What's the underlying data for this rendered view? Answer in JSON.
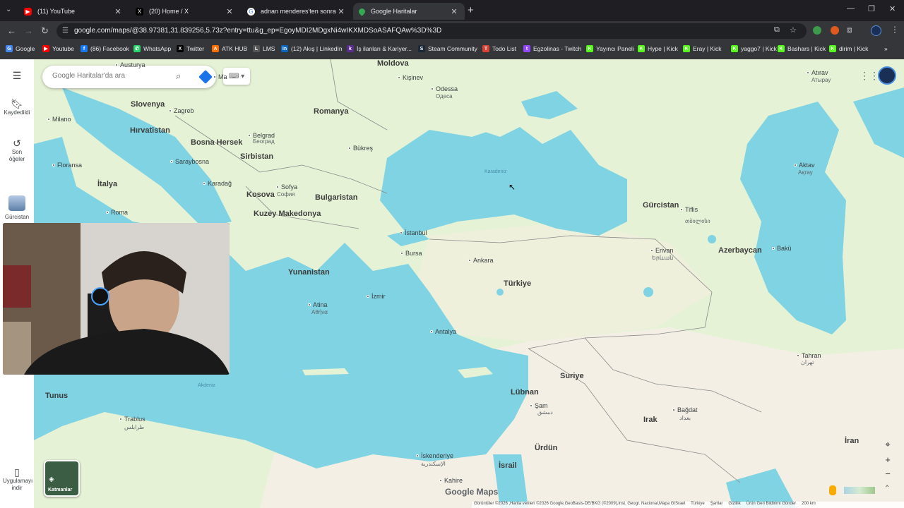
{
  "tabs": [
    {
      "title": "(11) YouTube",
      "icon": "youtube-icon",
      "color": "#ff0000"
    },
    {
      "title": "(20) Home / X",
      "icon": "x-icon",
      "color": "#000000"
    },
    {
      "title": "adnan menderes'ten sonraki cu",
      "icon": "google-icon",
      "color": "#4285f4"
    },
    {
      "title": "Google Haritalar",
      "icon": "maps-icon",
      "color": "#34a853"
    }
  ],
  "address": {
    "url": "google.com/maps/@38.97381,31.839256,5.73z?entry=ttu&g_ep=EgoyMDI2MDgxNi4wIKXMDSoASAFQAw%3D%3D"
  },
  "bookmarks": [
    {
      "label": "Google",
      "color": "#4285f4",
      "glyph": "G"
    },
    {
      "label": "Youtube",
      "color": "#ff0000",
      "glyph": "▶"
    },
    {
      "label": "(86) Facebook",
      "color": "#1877f2",
      "glyph": "f"
    },
    {
      "label": "WhatsApp",
      "color": "#25d366",
      "glyph": "✆"
    },
    {
      "label": "Twitter",
      "color": "#000000",
      "glyph": "X"
    },
    {
      "label": "ATK HUB",
      "color": "#ff6d00",
      "glyph": "A"
    },
    {
      "label": "LMS",
      "color": "#555555",
      "glyph": "L"
    },
    {
      "label": "(12) Akış | LinkedIn",
      "color": "#0a66c2",
      "glyph": "in"
    },
    {
      "label": "İş ilanları & Kariyer...",
      "color": "#5c2d91",
      "glyph": "k"
    },
    {
      "label": "Steam Community",
      "color": "#1b2838",
      "glyph": "S"
    },
    {
      "label": "Todo List",
      "color": "#db4035",
      "glyph": "T"
    },
    {
      "label": "Egzolinas - Twitch",
      "color": "#9146ff",
      "glyph": "t"
    },
    {
      "label": "Yayıncı Paneli",
      "color": "#53fc18",
      "glyph": "K"
    },
    {
      "label": "Hype | Kick",
      "color": "#53fc18",
      "glyph": "K"
    },
    {
      "label": "Eray | Kick",
      "color": "#53fc18",
      "glyph": "K"
    },
    {
      "label": "yaggo7 | Kick",
      "color": "#53fc18",
      "glyph": "K"
    },
    {
      "label": "Bashars | Kick",
      "color": "#53fc18",
      "glyph": "K"
    },
    {
      "label": "dirim | Kick",
      "color": "#53fc18",
      "glyph": "K"
    }
  ],
  "sidebar": {
    "saved": "Kaydedildi",
    "recent": "Son öğeler",
    "recent_place": "Gürcistan",
    "get_app": "Uygulamayı indir"
  },
  "search": {
    "placeholder": "Google Haritalar'da ara"
  },
  "layers": {
    "label": "Katmanlar"
  },
  "map_labels": {
    "countries": [
      "Moldova",
      "Romanya",
      "Slovenya",
      "Hırvatistan",
      "Bosna Hersek",
      "Sirbistan",
      "Bulgaristan",
      "İtalya",
      "Kosova",
      "Kuzey Makedonya",
      "Yunanistan",
      "Türkiye",
      "Gürcistan",
      "Azerbaycan",
      "Suriye",
      "Lübnan",
      "Irak",
      "Ürdün",
      "İsrail",
      "İran",
      "Tunus"
    ],
    "cities": [
      "Kişinev",
      "Odessa",
      "Zagreb",
      "Milano",
      "Bükreş",
      "Saraybosna",
      "Belgrad",
      "Floransa",
      "Karadağ",
      "Sofya",
      "Roma",
      "İstanbul",
      "Bursa",
      "Ankara",
      "İzmir",
      "Atina",
      "Antalya",
      "Tiflis",
      "Erivan",
      "Bakü",
      "Aktav",
      "Atırav",
      "Tahran",
      "Bağdat",
      "Şam",
      "Trablus",
      "İskenderiye",
      "Kahire",
      "Austurya",
      "Ma"
    ],
    "native": [
      "Одеса",
      "Београд",
      "София",
      "Αθήνα",
      "თბილისი",
      "Երևան",
      "Атырау",
      "Ақтау",
      "تهران",
      "بغداد",
      "دمشق",
      "طرابلس",
      "الإسكندرية"
    ],
    "seas": [
      "Karadeniz",
      "Akdeniz"
    ]
  },
  "footer": [
    "Görüntüler ©2026 ,Harita verileri ©2026 Google,GeoBasis-DE/BKG (©2009),Inst. Geogr. Nacional,Mapa GISrael",
    "Türkiye",
    "Şartlar",
    "Gizlilik",
    "Ürün Geri Bildirimi Gönder",
    "200 km"
  ],
  "brand": "Google Maps",
  "colors": {
    "water": "#7fd3e2",
    "land": "#e8f3d8",
    "land_arid": "#f4f0e6",
    "accent": "#1a73e8"
  }
}
